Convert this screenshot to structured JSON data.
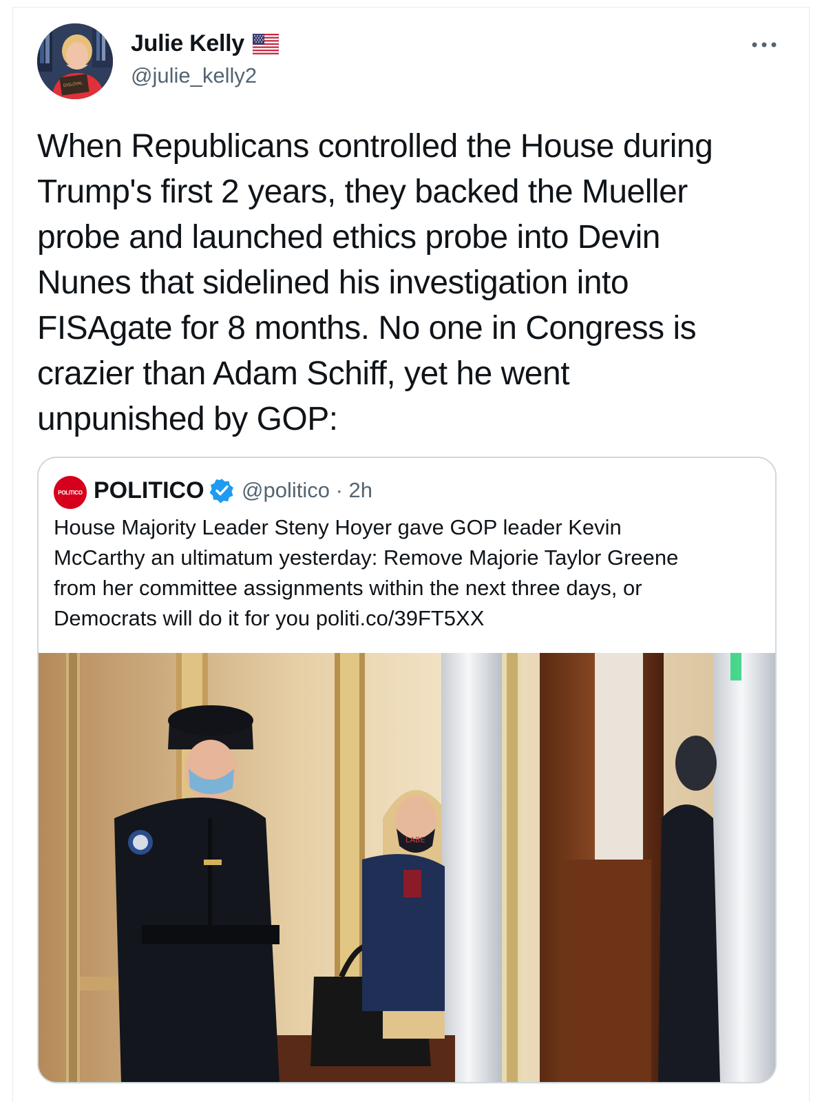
{
  "author": {
    "name": "Julie Kelly",
    "handle": "@julie_kelly2",
    "badge_icon": "us-flag-icon",
    "avatar_book_text": "DISLOYAL OPPOSITION"
  },
  "more_icon": "more-dots-icon",
  "tweet_text": "When Republicans controlled the House during\nTrump's first 2 years, they backed the Mueller\nprobe and launched ethics probe into Devin\nNunes that sidelined his investigation into\nFISAgate for 8 months. No one in Congress is\ncrazier than Adam Schiff, yet he went\nunpunished by GOP:",
  "quoted": {
    "logo_text": "POLITICO",
    "name": "POLITICO",
    "verified_icon": "verified-badge-icon",
    "handle_time": "@politico · 2h",
    "text": "House Majority Leader Steny Hoyer gave GOP leader Kevin\nMcCarthy an ultimatum yesterday: Remove Majorie Taylor Greene\nfrom her committee assignments within the next three days, or\nDemocrats will do it for you politi.co/39FT5XX",
    "photo_mask_text": "LABE"
  },
  "colors": {
    "text": "#0f1419",
    "secondary": "#536471",
    "border": "#cfd9de",
    "verified": "#1d9bf0",
    "politico_red": "#d6001c"
  }
}
